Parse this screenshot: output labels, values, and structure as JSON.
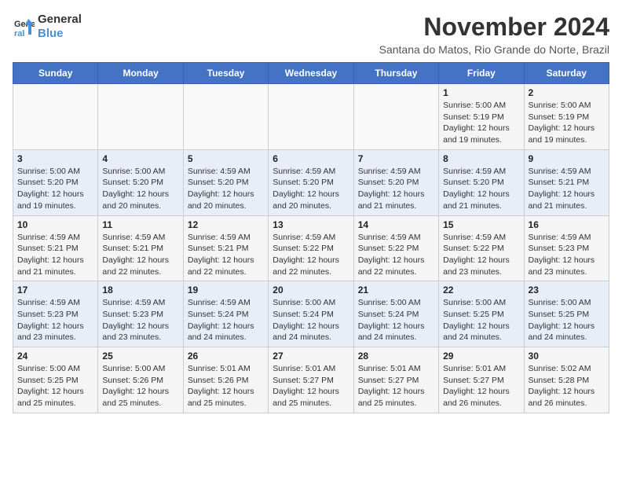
{
  "logo": {
    "line1": "General",
    "line2": "Blue"
  },
  "title": "November 2024",
  "subtitle": "Santana do Matos, Rio Grande do Norte, Brazil",
  "days_header": [
    "Sunday",
    "Monday",
    "Tuesday",
    "Wednesday",
    "Thursday",
    "Friday",
    "Saturday"
  ],
  "weeks": [
    [
      {
        "day": "",
        "info": ""
      },
      {
        "day": "",
        "info": ""
      },
      {
        "day": "",
        "info": ""
      },
      {
        "day": "",
        "info": ""
      },
      {
        "day": "",
        "info": ""
      },
      {
        "day": "1",
        "info": "Sunrise: 5:00 AM\nSunset: 5:19 PM\nDaylight: 12 hours and 19 minutes."
      },
      {
        "day": "2",
        "info": "Sunrise: 5:00 AM\nSunset: 5:19 PM\nDaylight: 12 hours and 19 minutes."
      }
    ],
    [
      {
        "day": "3",
        "info": "Sunrise: 5:00 AM\nSunset: 5:20 PM\nDaylight: 12 hours and 19 minutes."
      },
      {
        "day": "4",
        "info": "Sunrise: 5:00 AM\nSunset: 5:20 PM\nDaylight: 12 hours and 20 minutes."
      },
      {
        "day": "5",
        "info": "Sunrise: 4:59 AM\nSunset: 5:20 PM\nDaylight: 12 hours and 20 minutes."
      },
      {
        "day": "6",
        "info": "Sunrise: 4:59 AM\nSunset: 5:20 PM\nDaylight: 12 hours and 20 minutes."
      },
      {
        "day": "7",
        "info": "Sunrise: 4:59 AM\nSunset: 5:20 PM\nDaylight: 12 hours and 21 minutes."
      },
      {
        "day": "8",
        "info": "Sunrise: 4:59 AM\nSunset: 5:20 PM\nDaylight: 12 hours and 21 minutes."
      },
      {
        "day": "9",
        "info": "Sunrise: 4:59 AM\nSunset: 5:21 PM\nDaylight: 12 hours and 21 minutes."
      }
    ],
    [
      {
        "day": "10",
        "info": "Sunrise: 4:59 AM\nSunset: 5:21 PM\nDaylight: 12 hours and 21 minutes."
      },
      {
        "day": "11",
        "info": "Sunrise: 4:59 AM\nSunset: 5:21 PM\nDaylight: 12 hours and 22 minutes."
      },
      {
        "day": "12",
        "info": "Sunrise: 4:59 AM\nSunset: 5:21 PM\nDaylight: 12 hours and 22 minutes."
      },
      {
        "day": "13",
        "info": "Sunrise: 4:59 AM\nSunset: 5:22 PM\nDaylight: 12 hours and 22 minutes."
      },
      {
        "day": "14",
        "info": "Sunrise: 4:59 AM\nSunset: 5:22 PM\nDaylight: 12 hours and 22 minutes."
      },
      {
        "day": "15",
        "info": "Sunrise: 4:59 AM\nSunset: 5:22 PM\nDaylight: 12 hours and 23 minutes."
      },
      {
        "day": "16",
        "info": "Sunrise: 4:59 AM\nSunset: 5:23 PM\nDaylight: 12 hours and 23 minutes."
      }
    ],
    [
      {
        "day": "17",
        "info": "Sunrise: 4:59 AM\nSunset: 5:23 PM\nDaylight: 12 hours and 23 minutes."
      },
      {
        "day": "18",
        "info": "Sunrise: 4:59 AM\nSunset: 5:23 PM\nDaylight: 12 hours and 23 minutes."
      },
      {
        "day": "19",
        "info": "Sunrise: 4:59 AM\nSunset: 5:24 PM\nDaylight: 12 hours and 24 minutes."
      },
      {
        "day": "20",
        "info": "Sunrise: 5:00 AM\nSunset: 5:24 PM\nDaylight: 12 hours and 24 minutes."
      },
      {
        "day": "21",
        "info": "Sunrise: 5:00 AM\nSunset: 5:24 PM\nDaylight: 12 hours and 24 minutes."
      },
      {
        "day": "22",
        "info": "Sunrise: 5:00 AM\nSunset: 5:25 PM\nDaylight: 12 hours and 24 minutes."
      },
      {
        "day": "23",
        "info": "Sunrise: 5:00 AM\nSunset: 5:25 PM\nDaylight: 12 hours and 24 minutes."
      }
    ],
    [
      {
        "day": "24",
        "info": "Sunrise: 5:00 AM\nSunset: 5:25 PM\nDaylight: 12 hours and 25 minutes."
      },
      {
        "day": "25",
        "info": "Sunrise: 5:00 AM\nSunset: 5:26 PM\nDaylight: 12 hours and 25 minutes."
      },
      {
        "day": "26",
        "info": "Sunrise: 5:01 AM\nSunset: 5:26 PM\nDaylight: 12 hours and 25 minutes."
      },
      {
        "day": "27",
        "info": "Sunrise: 5:01 AM\nSunset: 5:27 PM\nDaylight: 12 hours and 25 minutes."
      },
      {
        "day": "28",
        "info": "Sunrise: 5:01 AM\nSunset: 5:27 PM\nDaylight: 12 hours and 25 minutes."
      },
      {
        "day": "29",
        "info": "Sunrise: 5:01 AM\nSunset: 5:27 PM\nDaylight: 12 hours and 26 minutes."
      },
      {
        "day": "30",
        "info": "Sunrise: 5:02 AM\nSunset: 5:28 PM\nDaylight: 12 hours and 26 minutes."
      }
    ]
  ]
}
